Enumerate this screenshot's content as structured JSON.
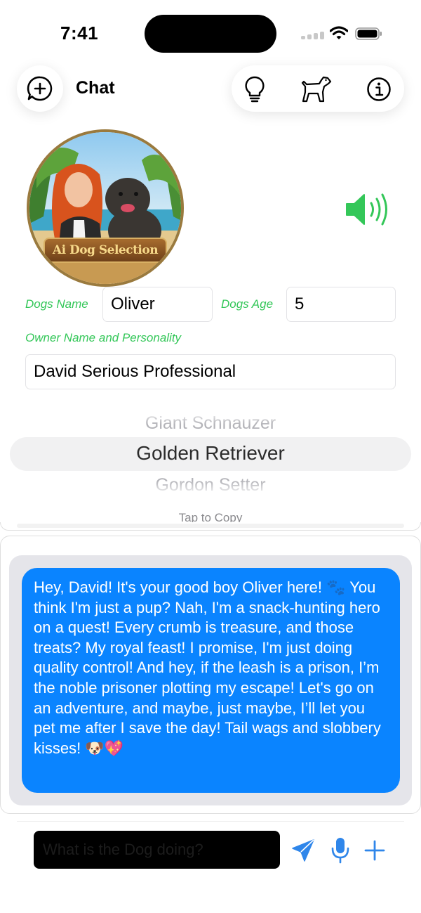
{
  "status_bar": {
    "time": "7:41"
  },
  "header": {
    "title": "Chat"
  },
  "toolbar": {
    "new_chat_icon": "plus-circle-icon",
    "icons": [
      "lightbulb-icon",
      "dog-icon",
      "info-icon"
    ]
  },
  "logo": {
    "text": "Ai Dog Selection"
  },
  "form": {
    "dogs_name_label": "Dogs Name",
    "dogs_name_value": "Oliver",
    "dogs_age_label": "Dogs Age",
    "dogs_age_value": "5",
    "owner_label": "Owner Name and Personality",
    "owner_value": "David Serious Professional"
  },
  "breed_picker": {
    "items": [
      "Giant Schnauzer",
      "Golden Retriever",
      "Gordon Setter"
    ],
    "selected": "Golden Retriever"
  },
  "tap_to_copy": "Tap to Copy",
  "message": {
    "text": "Hey, David! It's your good boy Oliver here! 🐾 You think I'm just a pup? Nah, I'm a snack-hunting hero on a quest! Every crumb is treasure, and those treats? My royal feast! I promise, I'm just doing quality control! And hey, if the leash is a prison, I’m the noble prisoner plotting my escape! Let's go on an adventure, and maybe, just maybe, I’ll let you pet me after I save the day! Tail wags and slobbery kisses! 🐶💖"
  },
  "input": {
    "placeholder": "What is the Dog doing?"
  },
  "colors": {
    "accent_green": "#34c759",
    "bubble_blue": "#0a84ff",
    "icon_blue": "#2f86ea"
  }
}
